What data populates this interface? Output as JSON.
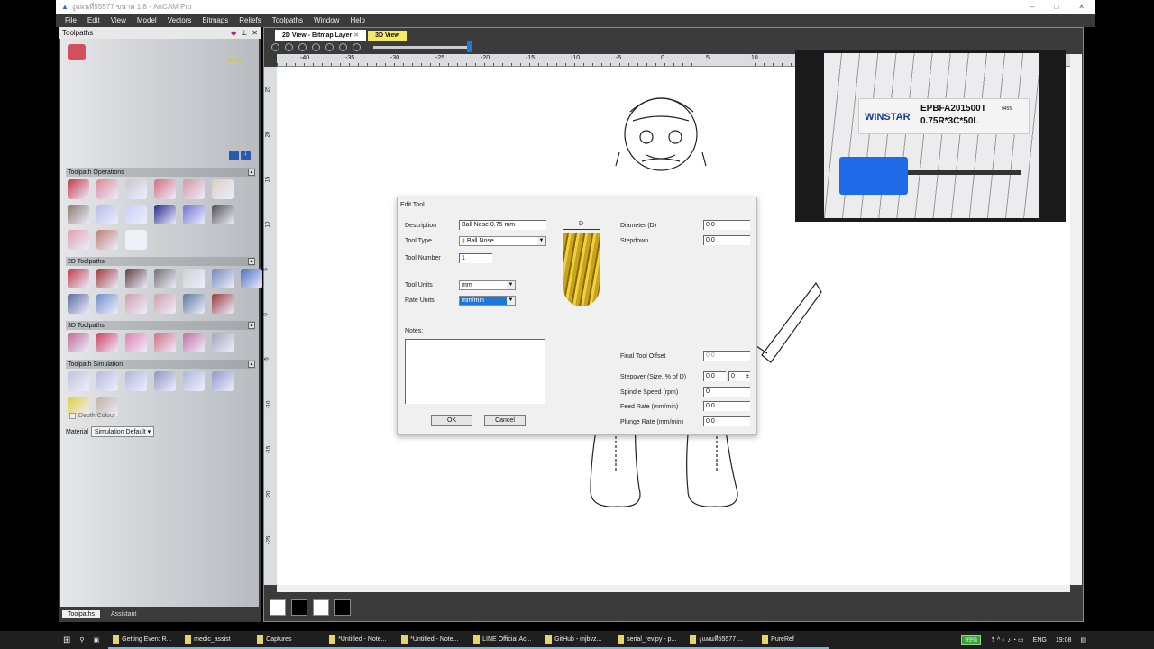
{
  "window": {
    "title": "งูแผนที่55577 ขนาด 1.8 - ArtCAM Pro"
  },
  "menu": [
    "File",
    "Edit",
    "View",
    "Model",
    "Vectors",
    "Bitmaps",
    "Reliefs",
    "Toolpaths",
    "Window",
    "Help"
  ],
  "left_panel": {
    "title": "Toolpaths",
    "groups": [
      {
        "title": "Toolpath Operations",
        "rows": [
          [
            "#c03a4a",
            "#d88a94",
            "#c8c8d0",
            "#d07080",
            "#d09aa0",
            "#d8d0c0"
          ],
          [
            "#8a7a6a",
            "#b8bce8",
            "#c8d0f0",
            "#2a2a8a",
            "#7070d0",
            "#505050"
          ],
          [
            "#e0a0aa",
            "#c08070",
            "#f0f0f0"
          ]
        ]
      },
      {
        "title": "2D Toolpaths",
        "rows": [
          [
            "#c03a4a",
            "#a03a3a",
            "#604040",
            "#707070",
            "#d0d0d0",
            "#7088b8",
            "#4a70c0"
          ],
          [
            "#5a6a9a",
            "#7090c8",
            "#d0a0a8",
            "#d0a0a8",
            "#5a7a9a",
            "#9a3a3a"
          ]
        ]
      },
      {
        "title": "3D Toolpaths",
        "rows": [
          [
            "#c06a90",
            "#d04060",
            "#e080b0",
            "#d07080",
            "#c070a0",
            "#a0a8b8"
          ]
        ]
      },
      {
        "title": "Toolpath Simulation",
        "rows": [
          [
            "#c0c4d8",
            "#b8bcd8",
            "#b0b8d8",
            "#9098c0",
            "#b0b8d8",
            "#9098c8"
          ],
          [
            "#e0d040",
            "#c0b0a0"
          ]
        ]
      }
    ],
    "depth_colour": "Depth Colour",
    "material_label": "Material",
    "material_value": "Simulation Default",
    "tabs": [
      "Toolpaths",
      "Assistant"
    ]
  },
  "view": {
    "tabs": [
      "2D View - Bitmap Layer",
      "3D View"
    ],
    "hruler": [
      "-40",
      "-35",
      "-30",
      "-25",
      "-20",
      "-15",
      "-10",
      "-5",
      "0",
      "5",
      "10"
    ],
    "vruler": [
      "25",
      "20",
      "15",
      "10",
      "5",
      "0",
      "-5",
      "-10",
      "-15",
      "-20",
      "-25"
    ]
  },
  "webcam": {
    "brand": "WINSTAR",
    "code": "EPBFA201500T",
    "spec": "0.75R*3C*50L",
    "small": "0455"
  },
  "dialog": {
    "title": "Edit Tool",
    "description_label": "Description",
    "description": "Ball Nose 0.75 mm",
    "tool_type_label": "Tool Type",
    "tool_type": "Ball Nose",
    "tool_number_label": "Tool Number",
    "tool_number": "1",
    "tool_units_label": "Tool Units",
    "tool_units": "mm",
    "rate_units_label": "Rate Units",
    "rate_units": "mm/min",
    "notes_label": "Notes:",
    "d_label": "D",
    "diameter_label": "Diameter (D)",
    "diameter": "0.0",
    "stepdown_label": "Stepdown",
    "stepdown": "0.0",
    "final_offset_label": "Final Tool Offset",
    "final_offset": "0.0",
    "stepover_label": "Stepover (Size, % of D)",
    "stepover": "0.0",
    "stepover_pct": "0",
    "spindle_label": "Spindle Speed (rpm)",
    "spindle": "0",
    "feed_label": "Feed Rate (mm/min)",
    "feed": "0.0",
    "plunge_label": "Plunge Rate (mm/min)",
    "plunge": "0.0",
    "ok": "OK",
    "cancel": "Cancel"
  },
  "taskbar": {
    "items": [
      "Getting Even: R...",
      "medic_assist",
      "Captures",
      "*Untitled - Note...",
      "*Untitled - Note...",
      "LINE Official Ac...",
      "GitHub - mjbvz...",
      "serial_rev.py - p...",
      "งูแผนที่55577 ...",
      "PureRef"
    ],
    "battery": "99%",
    "lang": "ENG",
    "time": "19:08"
  }
}
